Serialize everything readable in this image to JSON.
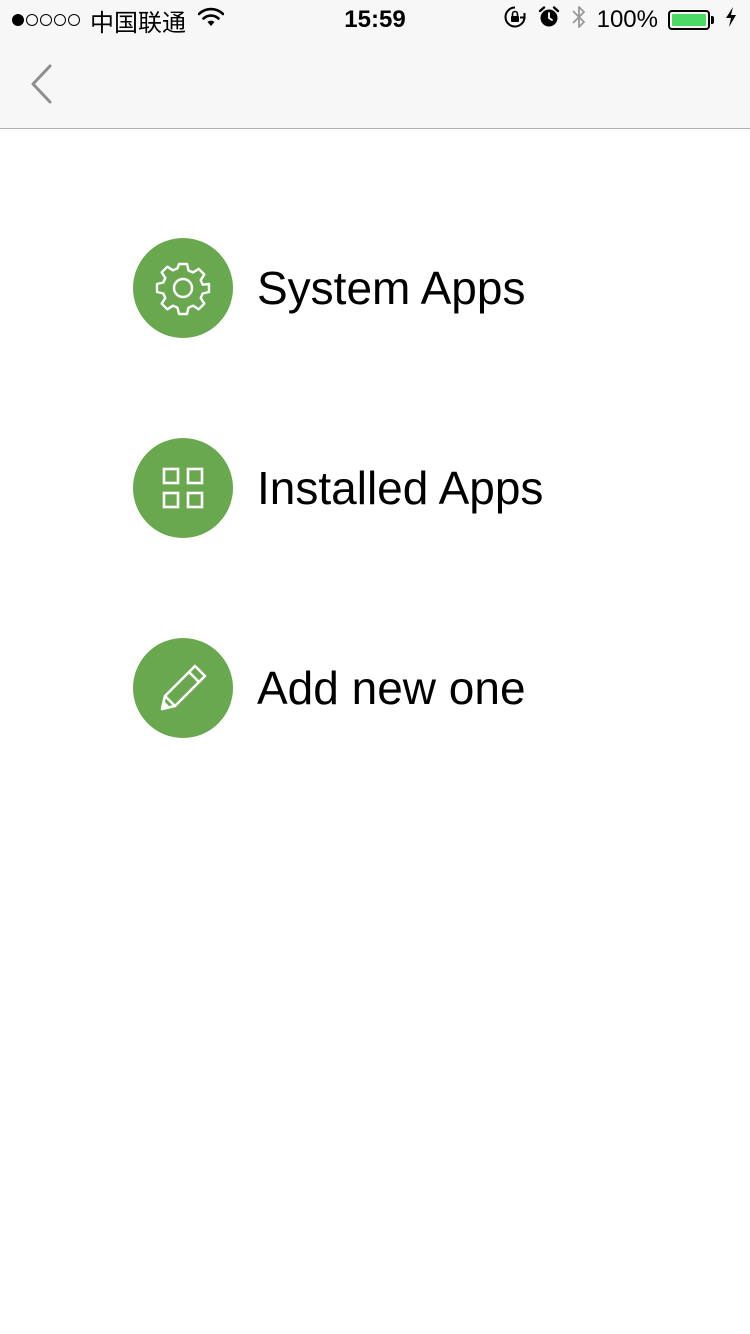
{
  "status_bar": {
    "carrier": "中国联通",
    "time": "15:59",
    "battery_percent": "100%",
    "signal_filled_dots": 1,
    "signal_total_dots": 5,
    "icons": [
      "wifi-icon",
      "rotation-lock-icon",
      "alarm-icon",
      "bluetooth-icon",
      "battery-icon",
      "charging-icon"
    ],
    "battery_color": "#4cd964"
  },
  "nav": {
    "back_icon": "chevron-left-icon"
  },
  "menu": {
    "accent_color": "#6aa84f",
    "items": [
      {
        "label": "System Apps",
        "icon": "gear-icon"
      },
      {
        "label": "Installed Apps",
        "icon": "grid-icon"
      },
      {
        "label": "Add new one",
        "icon": "pencil-icon"
      }
    ]
  }
}
